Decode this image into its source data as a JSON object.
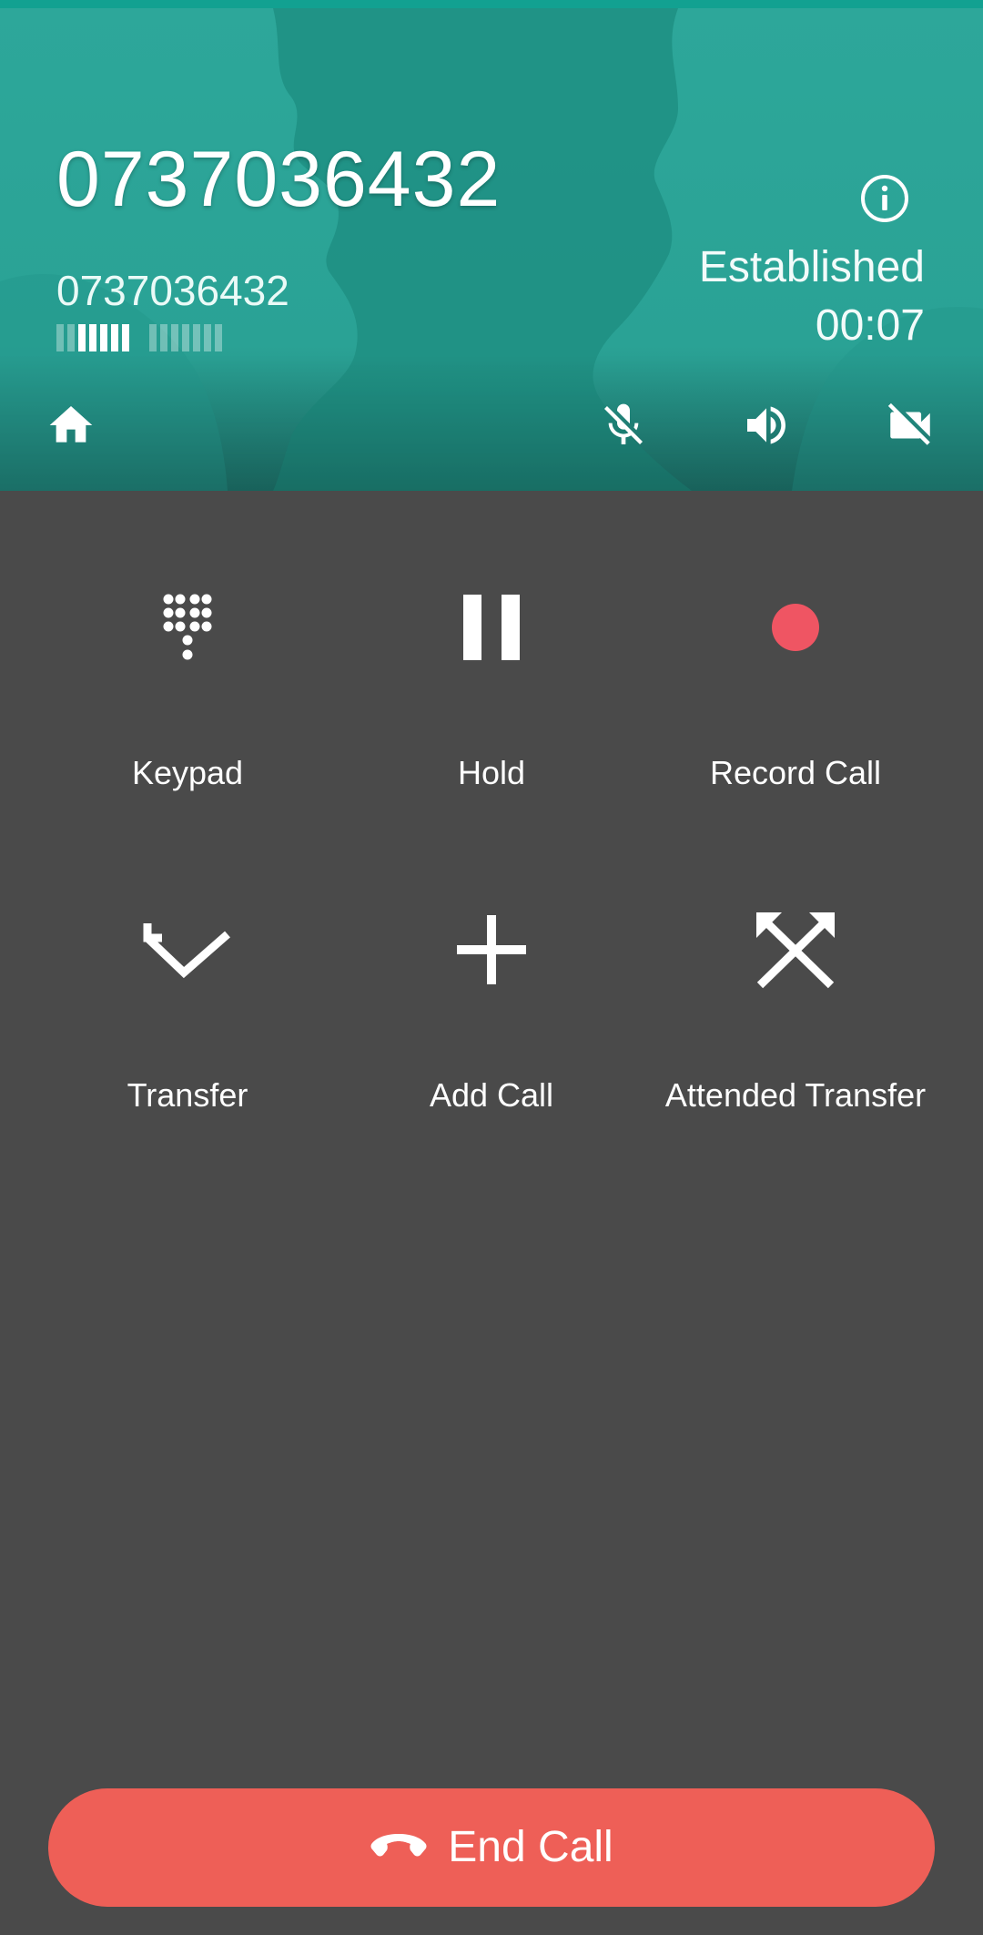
{
  "call": {
    "display_name": "0737036432",
    "number": "0737036432",
    "state": "Established",
    "timer": "00:07",
    "quality": {
      "received_level": 5,
      "sent_level": 0,
      "bars_per_group": 7
    }
  },
  "toolbar": {
    "home_icon": "home-icon",
    "mute_icon": "mic-off-icon",
    "speaker_icon": "volume-up-icon",
    "video_icon": "videocam-off-icon",
    "info_icon": "info-icon"
  },
  "actions": [
    {
      "id": "keypad",
      "label": "Keypad",
      "icon": "dialpad-icon"
    },
    {
      "id": "hold",
      "label": "Hold",
      "icon": "pause-icon"
    },
    {
      "id": "record",
      "label": "Record Call",
      "icon": "record-icon"
    },
    {
      "id": "transfer",
      "label": "Transfer",
      "icon": "call-transfer-icon"
    },
    {
      "id": "add-call",
      "label": "Add Call",
      "icon": "add-icon"
    },
    {
      "id": "attended-transfer",
      "label": "Attended Transfer",
      "icon": "call-merge-icon"
    }
  ],
  "end_call": {
    "label": "End Call",
    "icon": "call-end-icon"
  },
  "colors": {
    "header": "#2aa295",
    "status_bar": "#12a191",
    "background": "#4a4a4a",
    "end_call": "#ee5f57",
    "record_dot": "#ef5563"
  }
}
